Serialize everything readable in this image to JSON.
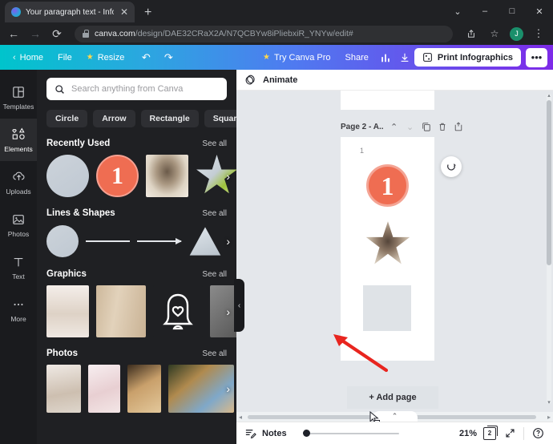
{
  "browser": {
    "tab": {
      "title": "Your paragraph text - Infographi",
      "close_label": "✕",
      "favicon": "canva-favicon"
    },
    "new_tab_label": "+",
    "window_controls": {
      "chevron": "⌄",
      "minimize": "–",
      "maximize": "□",
      "close": "✕"
    },
    "nav": {
      "back": "←",
      "forward": "→",
      "reload": "⟳"
    },
    "omnibox": {
      "domain": "canva.com",
      "path": "/design/DAE32CRaX2A/N7QCBYw8iPliebxiR_YNYw/edit#"
    },
    "actions": {
      "share": "share-icon",
      "bookmark": "☆",
      "profile_initial": "J",
      "menu": "⋮"
    }
  },
  "canva_toolbar": {
    "back_chevron": "‹",
    "home": "Home",
    "file": "File",
    "resize": "Resize",
    "undo": "↶",
    "redo": "↷",
    "try_pro": "Try Canva Pro",
    "share": "Share",
    "stats_icon": "bar-chart-icon",
    "download_icon": "download-icon",
    "print": "Print Infographics",
    "more": "•••"
  },
  "rail": {
    "items": [
      {
        "label": "Templates",
        "icon": "templates-icon",
        "active": false
      },
      {
        "label": "Elements",
        "icon": "elements-icon",
        "active": true
      },
      {
        "label": "Uploads",
        "icon": "uploads-icon",
        "active": false
      },
      {
        "label": "Photos",
        "icon": "photos-icon",
        "active": false
      },
      {
        "label": "Text",
        "icon": "text-icon",
        "active": false
      },
      {
        "label": "More",
        "icon": "more-icon",
        "active": false
      }
    ]
  },
  "panel": {
    "search_placeholder": "Search anything from Canva",
    "chips": [
      "Circle",
      "Arrow",
      "Rectangle",
      "Square"
    ],
    "chip_next": "›",
    "see_all": "See all",
    "next_arrow": "›",
    "sections": [
      {
        "title": "Recently Used"
      },
      {
        "title": "Lines & Shapes"
      },
      {
        "title": "Graphics"
      },
      {
        "title": "Photos"
      }
    ],
    "badge_number": "1",
    "collapse_handle": "‹"
  },
  "editor": {
    "animate_label": "Animate",
    "animate_icon": "animate-icon",
    "page_toolbar": {
      "label": "Page 2 - A..",
      "up": "⌃",
      "down": "⌄",
      "duplicate_icon": "duplicate-icon",
      "delete_icon": "trash-icon",
      "add_icon": "add-page-icon"
    },
    "page_number": "1",
    "badge_number": "1",
    "rotate_icon": "rotate-icon",
    "add_page": "+ Add page",
    "scroll_up": "▴",
    "scroll_down": "▾",
    "scroll_left": "◂",
    "scroll_right": "▸",
    "collapse_tab": "⌃",
    "cursor_icon": "drag-cursor-icon",
    "annotation_icon": "red-arrow-annotation"
  },
  "bottombar": {
    "notes_icon": "notes-icon",
    "notes_label": "Notes",
    "zoom_value": "21%",
    "page_count": "2",
    "expand_icon": "fullscreen-icon",
    "help_icon": "?"
  },
  "colors": {
    "accent_teal": "#00c4cc",
    "accent_purple": "#7d2ae8",
    "badge_orange": "#ef6d52",
    "annotation_red": "#e8251f",
    "panel_bg": "#1f2023",
    "rail_bg": "#1a1b1e"
  }
}
